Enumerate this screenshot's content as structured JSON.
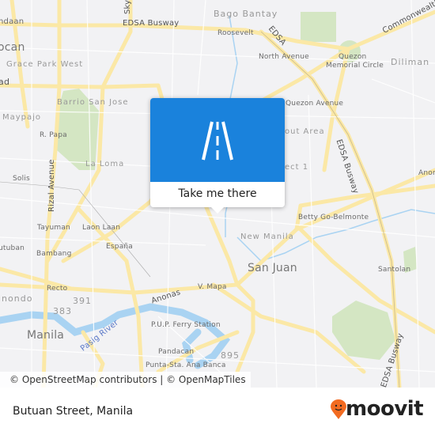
{
  "map": {
    "labels": {
      "ndaan": "ndaan",
      "bago_bantay": "Bago Bantay",
      "edsa_busway_top": "EDSA Busway",
      "roosevelt": "Roosevelt",
      "edsa": "EDSA",
      "commonwealth": "Commonwealth",
      "caloocan": "ocan",
      "north_avenue": "North Avenue",
      "quezon_circle_1": "Quezon",
      "quezon_circle_2": "Memorial Circle",
      "diliman": "Diliman",
      "grace_park_west": "Grace Park West",
      "road_ad": "ad",
      "barrio_san_jose": "Barrio San Jose",
      "quezon_avenue": "Quezon Avenue",
      "maypajo": "Maypajo",
      "r_papa": "R. Papa",
      "scout_area": "out Area",
      "la_loma": "La Loma",
      "project_1": "ect 1",
      "edsa_busway_right": "EDSA Busway",
      "solis": "Solis",
      "rizal_avenue": "Rizal Avenue",
      "anonas_right": "Anon",
      "betty_go": "Betty Go-Belmonte",
      "tayuman": "Tayuman",
      "laon_laan": "Laon Laan",
      "new_manila": "New Manila",
      "tutuban": "utuban",
      "bambang": "Bambang",
      "espana": "España",
      "san_juan": "San Juan",
      "santolan": "Santolan",
      "recto": "Recto",
      "v_mapa": "V. Mapa",
      "binondo": "inondo",
      "r391": "391",
      "anonas": "Anonas",
      "r383": "383",
      "pup_ferry": "P.U.P. Ferry Station",
      "manila": "Manila",
      "pasig_river": "Pasig River",
      "pandacan": "Pandacan",
      "r895": "895",
      "punta_sta_ana": "Punta-Sta. Ana Banca",
      "edsa_busway_bottom": "EDSA Busway",
      "sky": "Sky"
    },
    "attribution": "© OpenStreetMap contributors | © OpenMapTiles",
    "colors": {
      "road": "#fbe8a6",
      "park": "#d4e6c3",
      "water": "#a9d3f2",
      "land": "#f2f2f4",
      "accent": "#1a82dc"
    }
  },
  "popup": {
    "icon": "road-icon",
    "button_label": "Take me there"
  },
  "footer": {
    "title": "Butuan Street, Manila",
    "brand": "moovit",
    "brand_color": "#f26b21"
  }
}
